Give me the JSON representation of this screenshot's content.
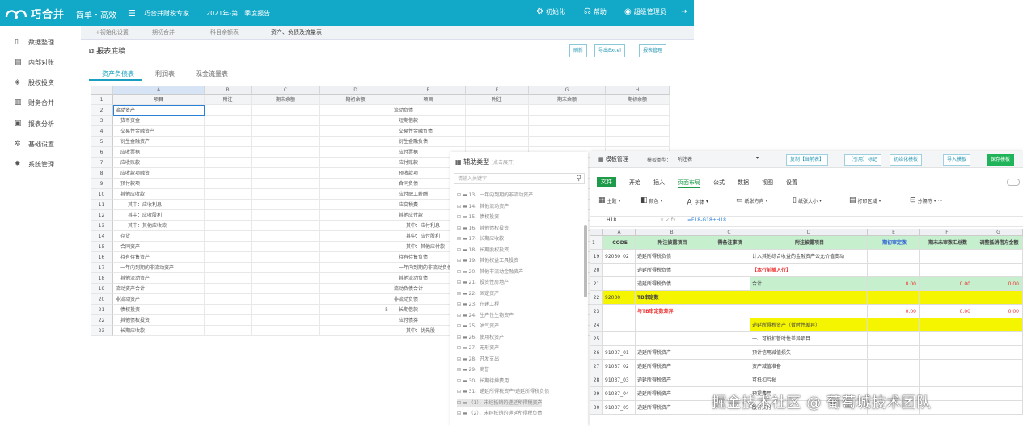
{
  "app": {
    "logo_text": "巧合并",
    "slogan": "简单・高效",
    "subtitle": "巧合并财税专家",
    "period": "2021年-第二季度报告",
    "right_menu": [
      {
        "icon": "gear-icon",
        "label": "初始化"
      },
      {
        "icon": "headset-icon",
        "label": "帮助"
      },
      {
        "icon": "user-icon",
        "label": "超级管理员"
      }
    ]
  },
  "sidebar": {
    "items": [
      {
        "icon": "data-icon",
        "label": "数据整理"
      },
      {
        "icon": "list-icon",
        "label": "内部对账"
      },
      {
        "icon": "shares-icon",
        "label": "股权投资"
      },
      {
        "icon": "chart-icon",
        "label": "财务合并"
      },
      {
        "icon": "report-icon",
        "label": "报表分析"
      },
      {
        "icon": "settings-icon",
        "label": "基础设置"
      },
      {
        "icon": "system-icon",
        "label": "系统管理"
      }
    ]
  },
  "page_tabs": [
    "+初始化设置",
    "期初合并",
    "科目余额表",
    "资产、负债及流量表"
  ],
  "page_title": "报表底稿",
  "toolbar": {
    "refresh": "刷新",
    "export_excel": "导出Excel",
    "manage": "报表管理"
  },
  "sub_tabs": [
    "资产负债表",
    "利润表",
    "现金流量表"
  ],
  "sheet": {
    "col_letters": [
      "A",
      "B",
      "C",
      "D",
      "E",
      "F",
      "G",
      "H"
    ],
    "header": [
      "项目",
      "附注",
      "期末余额",
      "期初余额",
      "项目",
      "附注",
      "期末余额",
      "期初余额"
    ],
    "rows": [
      {
        "n": "2",
        "a": "流动资产",
        "e": "流动负债"
      },
      {
        "n": "3",
        "a": "货币资金",
        "e": "短期借款"
      },
      {
        "n": "4",
        "a": "交易性金融资产",
        "e": "交易性金融负债"
      },
      {
        "n": "5",
        "a": "衍生金融资产",
        "e": "衍生金融负债"
      },
      {
        "n": "6",
        "a": "应收票据",
        "e": "应付票据"
      },
      {
        "n": "7",
        "a": "应收账款",
        "e": "应付账款"
      },
      {
        "n": "8",
        "a": "应收款项融资",
        "e": "预收款项"
      },
      {
        "n": "9",
        "a": "预付款项",
        "e": "合同负债"
      },
      {
        "n": "10",
        "a": "其他应收款",
        "e": "应付职工薪酬"
      },
      {
        "n": "11",
        "a": "其中：应收利息",
        "e": "应交税费"
      },
      {
        "n": "12",
        "a": "其中：应收股利",
        "e": "其他应付款"
      },
      {
        "n": "13",
        "a": "其中：其他应收款",
        "e": "其中：应付利息"
      },
      {
        "n": "14",
        "a": "存货",
        "e": "其中：应付股利"
      },
      {
        "n": "15",
        "a": "合同资产",
        "e": "其中：其他应付款"
      },
      {
        "n": "16",
        "a": "持有待售资产",
        "e": "持有待售负债"
      },
      {
        "n": "17",
        "a": "一年内到期的非流动资产",
        "e": "一年内到期的非流动负债"
      },
      {
        "n": "18",
        "a": "其他流动资产",
        "e": "其他流动负债"
      },
      {
        "n": "19",
        "a": "流动资产合计",
        "e": "流动负债合计"
      },
      {
        "n": "20",
        "a": "非流动资产",
        "e": "非流动负债"
      },
      {
        "n": "21",
        "a": "债权投资",
        "d": "5",
        "e": "长期借款"
      },
      {
        "n": "22",
        "a": "其他债权投资",
        "e": "应付债券"
      },
      {
        "n": "23",
        "a": "长期应收款",
        "e": "其中：优先股"
      }
    ]
  },
  "tree_panel": {
    "title": "辅助类型",
    "hint": "[点击展开]",
    "search_placeholder": "请输入关键字",
    "items": [
      "13、一年内到期的非流动资产",
      "14、其他流动资产",
      "15、债权投资",
      "16、其他债权投资",
      "17、长期应收款",
      "18、长期股权投资",
      "19、其他权益工具投资",
      "20、其他非流动金融资产",
      "21、投资性房地产",
      "22、固定资产",
      "23、在建工程",
      "24、生产性生物资产",
      "25、油气资产",
      "26、使用权资产",
      "27、无形资产",
      "28、开发支出",
      "29、商誉",
      "30、长期待摊费用",
      "31、递延所得税资产/递延所得税负债",
      "（1）、未经抵销的递延所得税资产",
      "（2）、未经抵销的递延所得税负债"
    ]
  },
  "template_panel": {
    "header": {
      "title": "模板管理",
      "type_label": "模板类型：",
      "type_value": "附注表"
    },
    "buttons": [
      "复制【当前表】",
      "【引用】标记",
      "初始化模板",
      "导入模板",
      "保存模板"
    ],
    "ribbon_tabs": [
      "文件",
      "开始",
      "插入",
      "页面布局",
      "公式",
      "数据",
      "视图",
      "设置"
    ],
    "tools": [
      "主题",
      "颜色",
      "字体",
      "纸张方向",
      "纸张大小",
      "打印区域",
      "分隔符"
    ],
    "cell_ref": "H18",
    "formula": "=F18-G18+H18",
    "col_letters": [
      "A",
      "B",
      "C",
      "D",
      "E",
      "F",
      "G"
    ],
    "col_headers": [
      "CODE",
      "附注披露项目",
      "需备注事项",
      "附注披露项目",
      "期初审定数",
      "期末未审数汇总数",
      "调整抵消借方金额"
    ],
    "rows": [
      {
        "n": "19",
        "code": "92030_02",
        "b": "递延所得税负债",
        "d": "计入其他综合收益的金融资产公允价值变动"
      },
      {
        "n": "20",
        "code": "",
        "b": "递延所得税负债",
        "d": "【本行前插入行】"
      },
      {
        "n": "21",
        "code": "",
        "b": "递延所得税负债",
        "d": "合计",
        "e": "0.00",
        "f": "0.00",
        "g": "0.00"
      },
      {
        "n": "22",
        "code": "92030",
        "b": "TB审定数",
        "d": ""
      },
      {
        "n": "23",
        "code": "",
        "b": "与TB审定数差异",
        "d": "",
        "e": "0.00",
        "f": "0.00",
        "g": "0.00"
      },
      {
        "n": "24",
        "code": "",
        "b": "",
        "d": "递延所得税资产（暂时性差异）"
      },
      {
        "n": "25",
        "code": "",
        "b": "",
        "d": "一、可抵扣暂时性差异项目"
      },
      {
        "n": "26",
        "code": "91037_01",
        "b": "递延所得税资产",
        "d": "预计信用减值损失"
      },
      {
        "n": "27",
        "code": "91037_02",
        "b": "递延所得税资产",
        "d": "资产减值准备"
      },
      {
        "n": "28",
        "code": "91037_03",
        "b": "递延所得税资产",
        "d": "可抵扣亏损"
      },
      {
        "n": "29",
        "code": "91037_04",
        "b": "递延所得税资产",
        "d": "预提费用"
      },
      {
        "n": "30",
        "code": "91037_05",
        "b": "递延所得税资产",
        "d": "股份支付"
      }
    ]
  },
  "watermark": "掘金技术社区 @ 葡萄城技术团队",
  "colors": {
    "brand": "#12a8c7",
    "green": "#1f9a4a",
    "yellow": "#f5f500",
    "header_green": "#c6efce"
  }
}
